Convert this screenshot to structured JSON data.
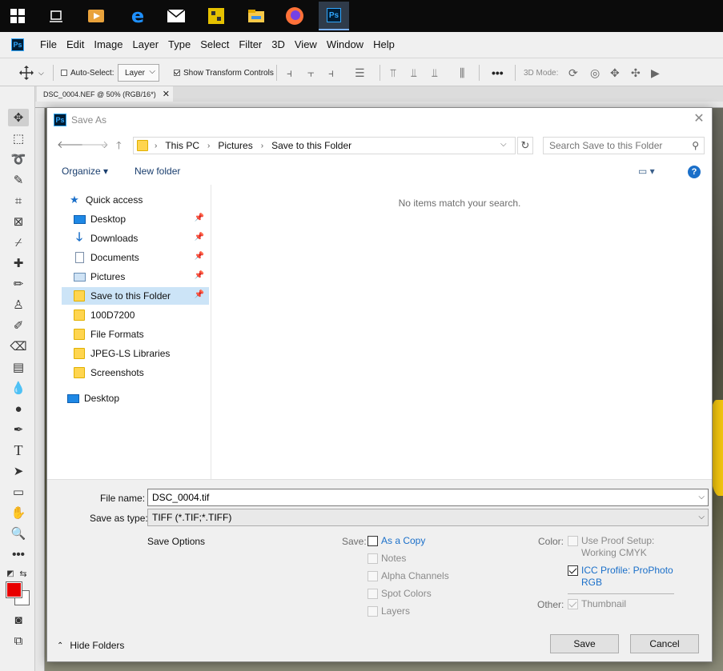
{
  "taskbar": {
    "icons": [
      "windows-start-icon",
      "task-view-icon",
      "media-player-icon",
      "edge-icon",
      "mail-icon",
      "app-icon",
      "file-explorer-icon",
      "firefox-icon",
      "photoshop-icon"
    ],
    "active_app": "Ps"
  },
  "menubar": {
    "logo": "Ps",
    "items": [
      "File",
      "Edit",
      "Image",
      "Layer",
      "Type",
      "Select",
      "Filter",
      "3D",
      "View",
      "Window",
      "Help"
    ]
  },
  "options_bar": {
    "auto_select_label": "Auto-Select:",
    "layer_value": "Layer",
    "show_transform_label": "Show Transform Controls",
    "more_label": "•••",
    "mode_3d_label": "3D Mode:"
  },
  "document": {
    "tab_title": "DSC_0004.NEF @ 50% (RGB/16*)",
    "close_glyph": "✕"
  },
  "colors": {
    "foreground": "#e80000",
    "background": "#ffffff",
    "accent": "#1a6fc9",
    "selection": "#cce4f7"
  },
  "dialog": {
    "title": "Save As",
    "logo": "Ps",
    "address": {
      "crumbs": [
        "This PC",
        "Pictures",
        "Save to this Folder"
      ]
    },
    "search_placeholder": "Search Save to this Folder",
    "organize_label": "Organize ▾",
    "new_folder_label": "New folder",
    "help_label": "?",
    "nav": {
      "quick_access": "Quick access",
      "items": [
        {
          "label": "Desktop",
          "icon": "desktop-icon",
          "pinned": true
        },
        {
          "label": "Downloads",
          "icon": "download-icon",
          "pinned": true
        },
        {
          "label": "Documents",
          "icon": "documents-icon",
          "pinned": true
        },
        {
          "label": "Pictures",
          "icon": "pictures-icon",
          "pinned": true
        },
        {
          "label": "Save to this Folder",
          "icon": "folder-icon",
          "pinned": true,
          "selected": true
        },
        {
          "label": "100D7200",
          "icon": "folder-icon",
          "pinned": false
        },
        {
          "label": "File Formats",
          "icon": "folder-icon",
          "pinned": false
        },
        {
          "label": "JPEG-LS Libraries",
          "icon": "folder-icon",
          "pinned": false
        },
        {
          "label": "Screenshots",
          "icon": "folder-icon",
          "pinned": false
        }
      ],
      "desktop_root": "Desktop"
    },
    "empty_message": "No items match your search.",
    "file_name_label": "File name:",
    "file_name_value": "DSC_0004.tif",
    "save_type_label": "Save as type:",
    "save_type_value": "TIFF (*.TIF;*.TIFF)",
    "save_options_label": "Save Options",
    "save_label": "Save:",
    "save_checks": [
      {
        "label": "As a Copy",
        "checked": false,
        "enabled": true
      },
      {
        "label": "Notes",
        "checked": false,
        "enabled": false
      },
      {
        "label": "Alpha Channels",
        "checked": false,
        "enabled": false
      },
      {
        "label": "Spot Colors",
        "checked": false,
        "enabled": false
      },
      {
        "label": "Layers",
        "checked": false,
        "enabled": false
      }
    ],
    "color_label": "Color:",
    "proof_label_1": "Use Proof Setup:",
    "proof_label_2": "Working CMYK",
    "icc_label_1": "ICC Profile:  ProPhoto",
    "icc_label_2": "RGB",
    "other_label": "Other:",
    "thumbnail_label": "Thumbnail",
    "hide_folders_label": "Hide Folders",
    "save_button": "Save",
    "cancel_button": "Cancel"
  }
}
